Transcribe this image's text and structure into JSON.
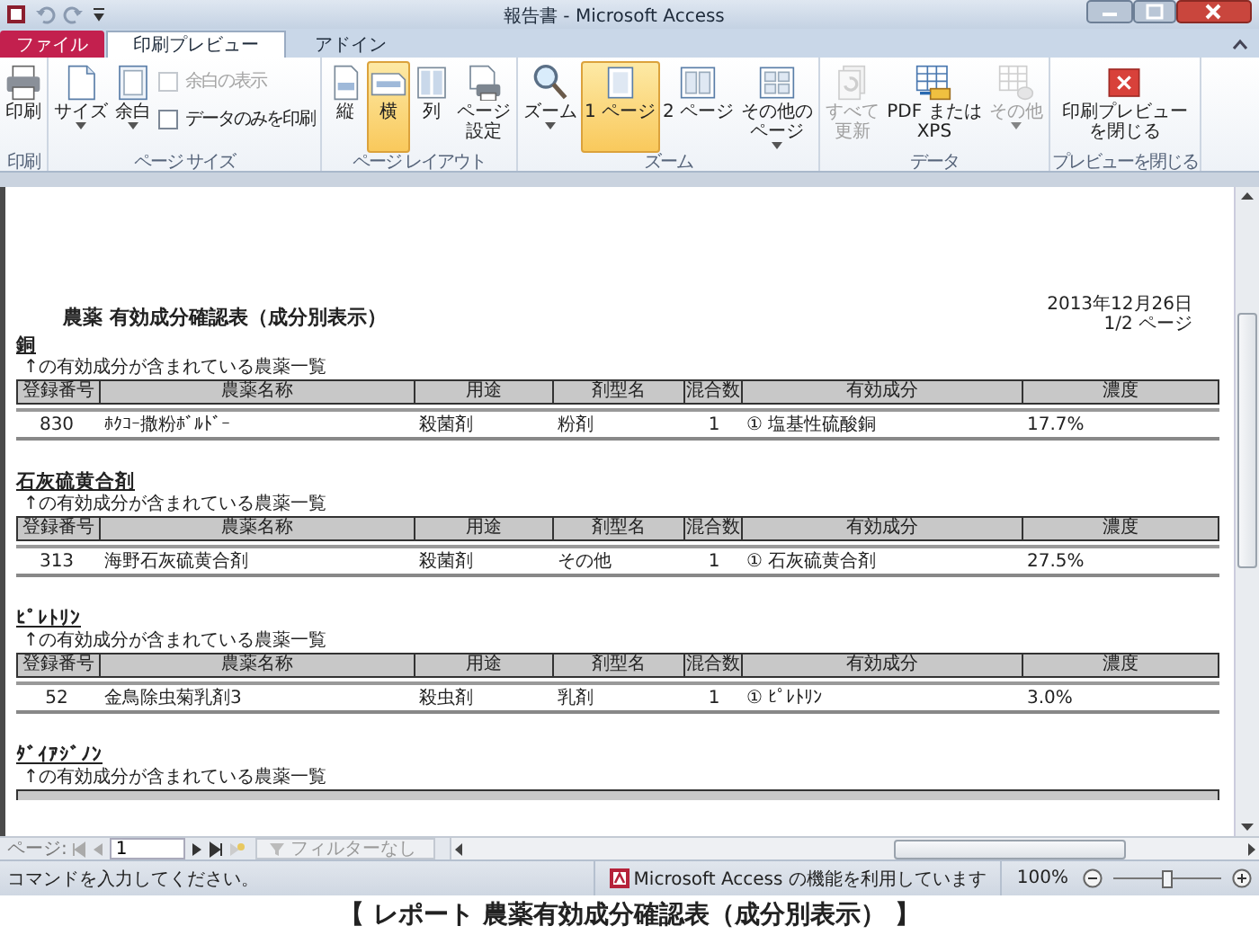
{
  "window": {
    "title": "報告書 - Microsoft Access"
  },
  "tabs": [
    {
      "label": "ファイル",
      "kind": "file",
      "selected": false
    },
    {
      "label": "印刷プレビュー",
      "kind": "tab",
      "selected": true
    },
    {
      "label": "アドイン",
      "kind": "tab",
      "selected": false
    }
  ],
  "ribbon_groups": [
    {
      "label": "印刷",
      "items": [
        {
          "kind": "large",
          "label": [
            "印刷"
          ],
          "selected": false,
          "disabled": false,
          "dropdown": false
        }
      ]
    },
    {
      "label": "ページ サイズ",
      "items": [
        {
          "kind": "large",
          "label": [
            "サイズ"
          ],
          "selected": false,
          "disabled": false,
          "dropdown": true
        },
        {
          "kind": "large",
          "label": [
            "余白"
          ],
          "selected": false,
          "disabled": false,
          "dropdown": true
        },
        {
          "kind": "checkbox",
          "label": "余白の表示",
          "checked": false,
          "disabled": true
        },
        {
          "kind": "checkbox",
          "label": "データのみを印刷",
          "checked": false,
          "disabled": false
        }
      ]
    },
    {
      "label": "ページ レイアウト",
      "items": [
        {
          "kind": "large",
          "label": [
            "縦"
          ],
          "selected": false,
          "disabled": false,
          "dropdown": false
        },
        {
          "kind": "large",
          "label": [
            "横"
          ],
          "selected": true,
          "disabled": false,
          "dropdown": false
        },
        {
          "kind": "large",
          "label": [
            "列"
          ],
          "selected": false,
          "disabled": false,
          "dropdown": false
        },
        {
          "kind": "large",
          "label": [
            "ページ",
            "設定"
          ],
          "selected": false,
          "disabled": false,
          "dropdown": false
        }
      ]
    },
    {
      "label": "ズーム",
      "items": [
        {
          "kind": "large",
          "label": [
            "ズーム"
          ],
          "selected": false,
          "disabled": false,
          "dropdown": true
        },
        {
          "kind": "large",
          "label": [
            "1 ページ"
          ],
          "selected": true,
          "disabled": false,
          "dropdown": false
        },
        {
          "kind": "large",
          "label": [
            "2 ページ"
          ],
          "selected": false,
          "disabled": false,
          "dropdown": false
        },
        {
          "kind": "large",
          "label": [
            "その他の",
            "ページ"
          ],
          "selected": false,
          "disabled": false,
          "dropdown": true
        }
      ]
    },
    {
      "label": "データ",
      "items": [
        {
          "kind": "large",
          "label": [
            "すべて",
            "更新"
          ],
          "selected": false,
          "disabled": true,
          "dropdown": false
        },
        {
          "kind": "large",
          "label": [
            "PDF または",
            "XPS"
          ],
          "selected": false,
          "disabled": false,
          "dropdown": false
        },
        {
          "kind": "large",
          "label": [
            "その他"
          ],
          "selected": false,
          "disabled": true,
          "dropdown": true
        }
      ]
    },
    {
      "label": "プレビューを閉じる",
      "items": [
        {
          "kind": "large",
          "label": [
            "印刷プレビュー",
            "を閉じる"
          ],
          "selected": false,
          "disabled": false,
          "dropdown": false
        }
      ]
    }
  ],
  "report": {
    "title": "農薬 有効成分確認表（成分別表示）",
    "date": "2013年12月26日",
    "page": "1/2 ページ",
    "sections": [
      {
        "heading": "銅",
        "subtitle": "↑の有効成分が含まれている農薬一覧",
        "cut_off": false,
        "columns": [
          "登録番号",
          "農薬名称",
          "用途",
          "剤型名",
          "混合数",
          "有効成分",
          "濃度"
        ],
        "rows": [
          [
            "830",
            "ﾎｸｺｰ撒粉ﾎﾞﾙﾄﾞｰ",
            "殺菌剤",
            "粉剤",
            "1",
            "① 塩基性硫酸銅",
            "17.7%"
          ]
        ]
      },
      {
        "heading": "石灰硫黄合剤",
        "subtitle": "↑の有効成分が含まれている農薬一覧",
        "cut_off": false,
        "columns": [
          "登録番号",
          "農薬名称",
          "用途",
          "剤型名",
          "混合数",
          "有効成分",
          "濃度"
        ],
        "rows": [
          [
            "313",
            "海野石灰硫黄合剤",
            "殺菌剤",
            "その他",
            "1",
            "① 石灰硫黄合剤",
            "27.5%"
          ]
        ]
      },
      {
        "heading": "ﾋﾟﾚﾄﾘﾝ",
        "subtitle": "↑の有効成分が含まれている農薬一覧",
        "cut_off": false,
        "columns": [
          "登録番号",
          "農薬名称",
          "用途",
          "剤型名",
          "混合数",
          "有効成分",
          "濃度"
        ],
        "rows": [
          [
            "52",
            "金鳥除虫菊乳剤3",
            "殺虫剤",
            "乳剤",
            "1",
            "① ﾋﾟﾚﾄﾘﾝ",
            "3.0%"
          ]
        ]
      },
      {
        "heading": "ﾀﾞｲｱｼﾞﾉﾝ",
        "subtitle": "↑の有効成分が含まれている農薬一覧",
        "cut_off": true
      }
    ]
  },
  "navigation": {
    "label": "ページ:",
    "page": "1",
    "filter": "フィルターなし",
    "filter_disabled": true
  },
  "status_bar": {
    "message": "コマンドを入力してください。",
    "feature": "Microsoft Access の機能を利用しています",
    "zoom": {
      "reading": "100%",
      "level": 0.5
    }
  },
  "caption": "【 レポート 農薬有効成分確認表（成分別表示） 】"
}
